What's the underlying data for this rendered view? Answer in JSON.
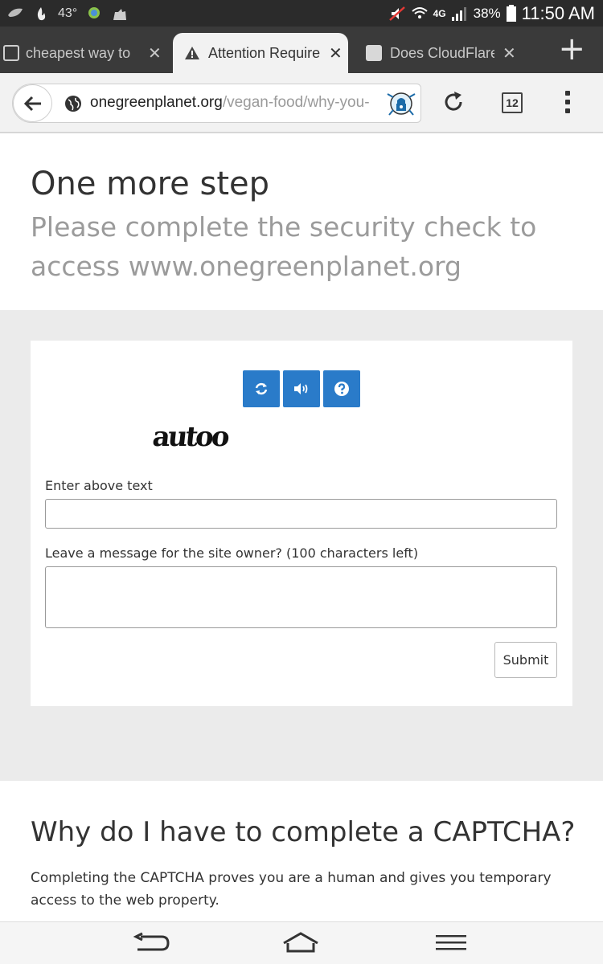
{
  "status_bar": {
    "temperature": "43°",
    "network": "4G",
    "battery": "38%",
    "time": "11:50 AM"
  },
  "tabs": [
    {
      "label": "cheapest way to",
      "active": false
    },
    {
      "label": "Attention Require",
      "active": true
    },
    {
      "label": "Does CloudFlare",
      "active": false
    }
  ],
  "toolbar": {
    "url_domain": "onegreenplanet.org",
    "url_path": "/vegan-food/why-you-",
    "tab_count": "12"
  },
  "page": {
    "title": "One more step",
    "subtitle": "Please complete the security check to access www.onegreenplanet.org"
  },
  "form": {
    "captcha_text": "autoo",
    "enter_label": "Enter above text",
    "enter_value": "",
    "message_label": "Leave a message for the site owner? (100 characters left)",
    "message_value": "",
    "submit_label": "Submit"
  },
  "why": {
    "heading": "Why do I have to complete a CAPTCHA?",
    "body": "Completing the CAPTCHA proves you are a human and gives you temporary access to the web property."
  },
  "colors": {
    "accent": "#2a7bc9",
    "gray_bg": "#ebebeb"
  },
  "icons": [
    "leaf-icon",
    "fire-icon",
    "android-icon",
    "cat-icon",
    "mute-icon",
    "wifi-icon",
    "signal-icon",
    "battery-icon",
    "warning-icon",
    "globe-icon",
    "refresh-icon",
    "audio-icon",
    "help-icon",
    "back-icon",
    "home-icon",
    "menu-icon"
  ]
}
